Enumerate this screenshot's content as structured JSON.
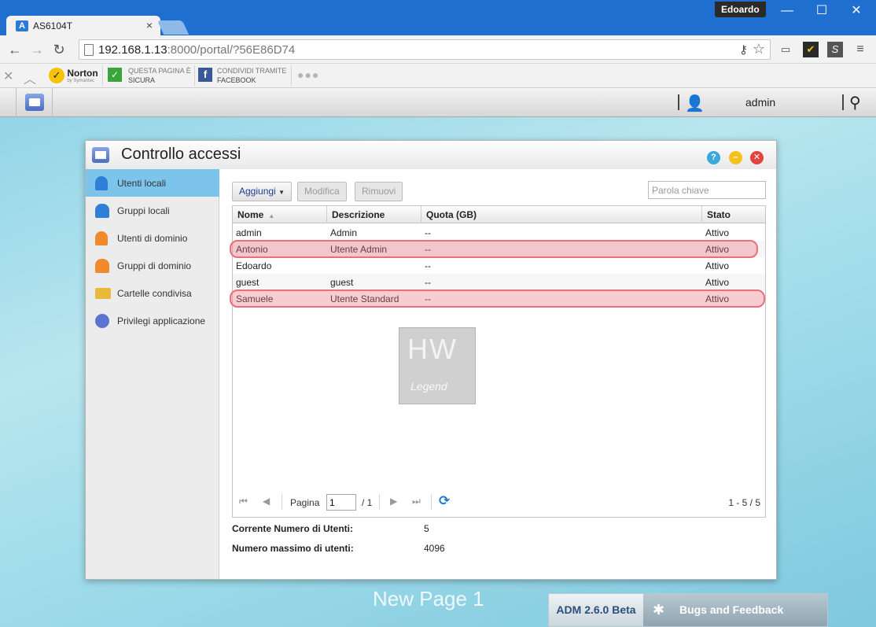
{
  "browser": {
    "tab_title": "AS6104T",
    "tab_favicon": "A",
    "profile_name": "Edoardo",
    "url_host": "192.168.1.13",
    "url_rest": ":8000/portal/?56E86D74",
    "toolbar": {
      "norton_brand": "Norton",
      "norton_sub": "by Symantec",
      "safe_line1": "QUESTA PAGINA È",
      "safe_line2": "SICURA",
      "share_line1": "CONDIVIDI TRAMITE",
      "share_line2": "FACEBOOK"
    }
  },
  "portal": {
    "username": "admin"
  },
  "panel": {
    "title": "Controllo accessi",
    "sidebar": [
      {
        "label": "Utenti locali",
        "icon": "user-icon",
        "color": "#2f7fd6"
      },
      {
        "label": "Gruppi locali",
        "icon": "group-icon",
        "color": "#2f7fd6"
      },
      {
        "label": "Utenti di dominio",
        "icon": "domain-user-icon",
        "color": "#f08a2c"
      },
      {
        "label": "Gruppi di dominio",
        "icon": "domain-group-icon",
        "color": "#f08a2c"
      },
      {
        "label": "Cartelle condivisa",
        "icon": "folder-icon",
        "color": "#e8b93a"
      },
      {
        "label": "Privilegi applicazione",
        "icon": "app-privilege-icon",
        "color": "#5b74d0"
      }
    ],
    "buttons": {
      "add": "Aggiungi",
      "edit": "Modifica",
      "remove": "Rimuovi"
    },
    "search_placeholder": "Parola chiave",
    "columns": [
      "Nome",
      "Descrizione",
      "Quota (GB)",
      "Stato"
    ],
    "rows": [
      {
        "name": "admin",
        "desc": "Admin",
        "quota": "--",
        "status": "Attivo"
      },
      {
        "name": "Antonio",
        "desc": "Utente Admin",
        "quota": "--",
        "status": "Attivo"
      },
      {
        "name": "Edoardo",
        "desc": "",
        "quota": "--",
        "status": "Attivo"
      },
      {
        "name": "guest",
        "desc": "guest",
        "quota": "--",
        "status": "Attivo"
      },
      {
        "name": "Samuele",
        "desc": "Utente Standard",
        "quota": "--",
        "status": "Attivo"
      }
    ],
    "pager": {
      "page_label": "Pagina",
      "page_value": "1",
      "page_total": "/ 1",
      "range": "1 - 5 / 5"
    },
    "stats": {
      "current_label": "Corrente Numero di Utenti:",
      "current_value": "5",
      "max_label": "Numero massimo di utenti:",
      "max_value": "4096"
    }
  },
  "watermark": {
    "line1": "HW",
    "line2": "Legend"
  },
  "footer": {
    "page_name": "New Page 1",
    "version": "ADM 2.6.0 Beta",
    "feedback": "Bugs and Feedback"
  }
}
